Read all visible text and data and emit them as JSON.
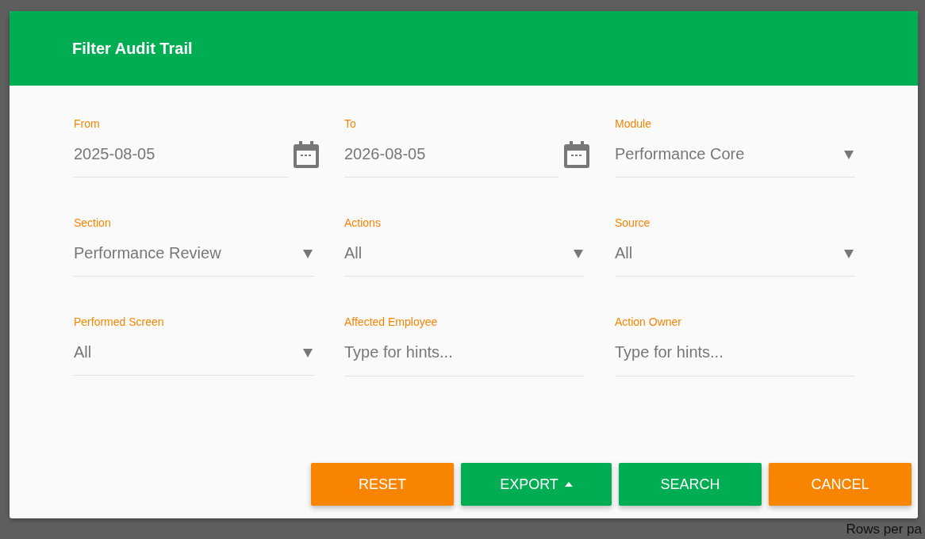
{
  "background": {
    "footer_text": "Rows per pa"
  },
  "dialog": {
    "title": "Filter Audit Trail",
    "fields": [
      {
        "kind": "date",
        "label": "From",
        "value": "2025-08-05"
      },
      {
        "kind": "date",
        "label": "To",
        "value": "2026-08-05"
      },
      {
        "kind": "select",
        "label": "Module",
        "value": "Performance Core"
      },
      {
        "kind": "select",
        "label": "Section",
        "value": "Performance Review"
      },
      {
        "kind": "select",
        "label": "Actions",
        "value": "All"
      },
      {
        "kind": "select",
        "label": "Source",
        "value": "All"
      },
      {
        "kind": "select",
        "label": "Performed Screen",
        "value": "All"
      },
      {
        "kind": "text",
        "label": "Affected Employee",
        "placeholder": "Type for hints..."
      },
      {
        "kind": "text",
        "label": "Action Owner",
        "placeholder": "Type for hints..."
      }
    ],
    "buttons": [
      {
        "label": "RESET",
        "kind": "plain",
        "color": "#f88400"
      },
      {
        "label": "EXPORT",
        "kind": "menu",
        "color": "#00ad52"
      },
      {
        "label": "SEARCH",
        "kind": "plain",
        "color": "#00ad52"
      },
      {
        "label": "CANCEL",
        "kind": "plain",
        "color": "#f88400"
      }
    ]
  }
}
